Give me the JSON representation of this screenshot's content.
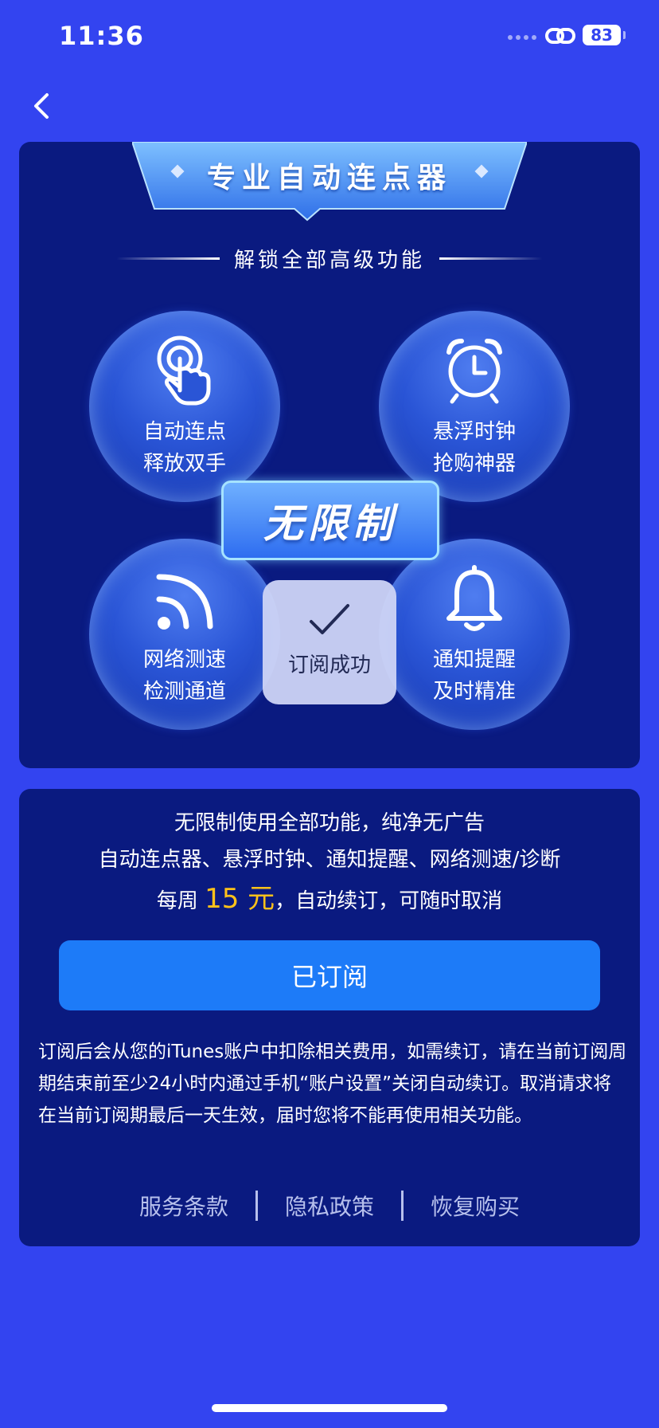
{
  "status_bar": {
    "time": "11:36",
    "battery": "83"
  },
  "header": {
    "back_icon": "chevron-left-icon"
  },
  "hero": {
    "title": "专业自动连点器",
    "subtitle": "解锁全部高级功能",
    "badge": "无限制",
    "features": [
      {
        "icon": "tap-hand-icon",
        "line1": "自动连点",
        "line2": "释放双手"
      },
      {
        "icon": "alarm-clock-icon",
        "line1": "悬浮时钟",
        "line2": "抢购神器"
      },
      {
        "icon": "wifi-signal-icon",
        "line1": "网络测速",
        "line2": "检测通道"
      },
      {
        "icon": "bell-icon",
        "line1": "通知提醒",
        "line2": "及时精准"
      }
    ]
  },
  "toast": {
    "icon": "checkmark-icon",
    "text": "订阅成功"
  },
  "plan": {
    "line1": "无限制使用全部功能，纯净无广告",
    "line2": "自动连点器、悬浮时钟、通知提醒、网络测速/诊断",
    "price_prefix": "每周 ",
    "price": "15 元",
    "price_suffix": "，自动续订，可随时取消",
    "button_label": "已订阅",
    "terms": "订阅后会从您的iTunes账户中扣除相关费用，如需续订，请在当前订阅周期结束前至少24小时内通过手机“账户设置”关闭自动续订。取消请求将在当前订阅期最后一天生效，届时您将不能再使用相关功能。"
  },
  "footer": {
    "links": [
      "服务条款",
      "隐私政策",
      "恢复购买"
    ]
  },
  "colors": {
    "background": "#3344f0",
    "card": "#0a1a80",
    "button": "#1d7bf8",
    "price": "#ffc21a"
  }
}
